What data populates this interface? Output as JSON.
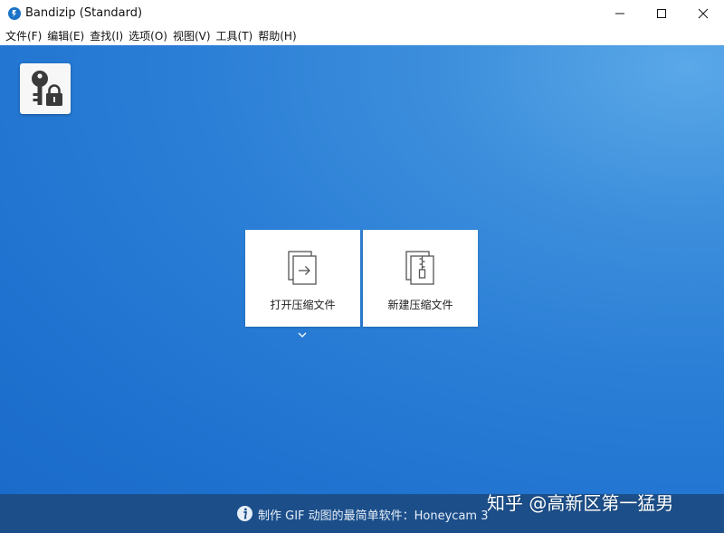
{
  "window": {
    "title": "Bandizip (Standard)",
    "icon": "bandizip-app-icon"
  },
  "window_controls": [
    "minimize-icon",
    "maximize-icon",
    "close-icon"
  ],
  "menubar": {
    "items": [
      {
        "label": "文件(F)"
      },
      {
        "label": "编辑(E)"
      },
      {
        "label": "查找(I)"
      },
      {
        "label": "选项(O)"
      },
      {
        "label": "视图(V)"
      },
      {
        "label": "工具(T)"
      },
      {
        "label": "帮助(H)"
      }
    ]
  },
  "main": {
    "password_tile_icon": "key-lock-icon",
    "tiles": [
      {
        "label": "打开压缩文件",
        "icon": "open-archive-icon"
      },
      {
        "label": "新建压缩文件",
        "icon": "new-archive-icon"
      }
    ],
    "dropdown_icon": "chevron-down-icon"
  },
  "adbar": {
    "text": "制作 GIF 动图的最简单软件：Honeycam 3",
    "icon": "info-icon"
  },
  "watermark": {
    "text": "知乎 @高新区第一猛男"
  },
  "colors": {
    "main_bg": "#2b7fd6",
    "adbar_bg": "#1c4f8a",
    "tile_bg": "#ffffff",
    "accent": "#1a73c8"
  }
}
